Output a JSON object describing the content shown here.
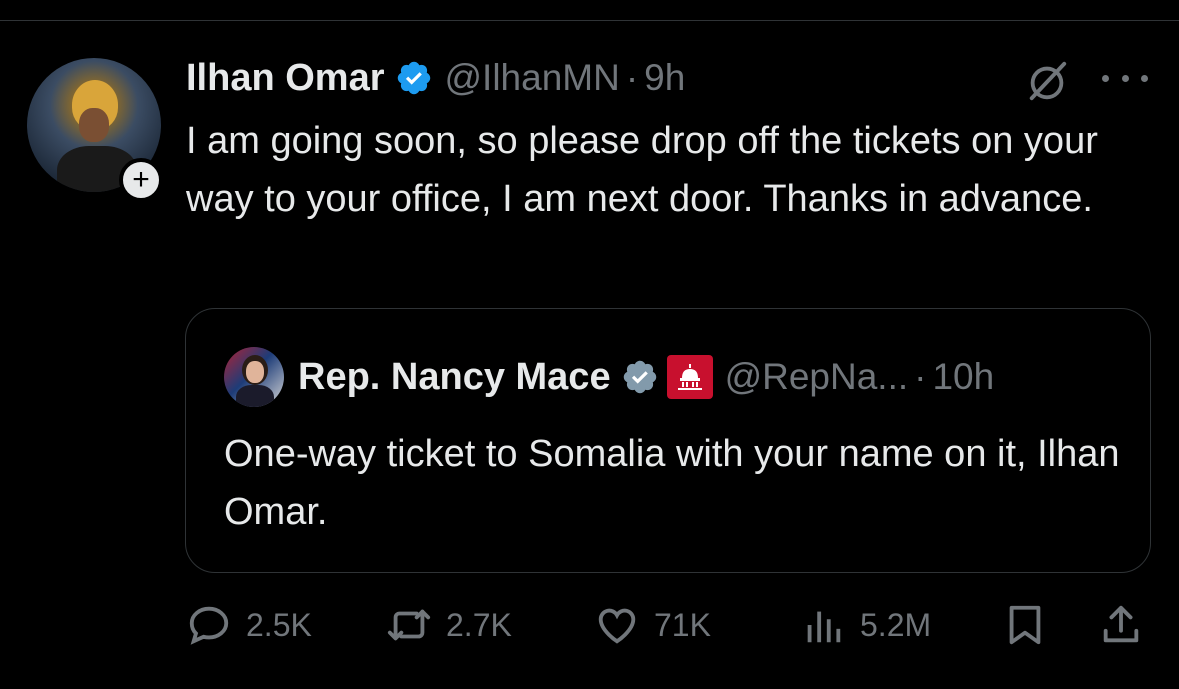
{
  "tweet": {
    "author": {
      "display_name": "Ilhan Omar",
      "handle": "@IlhanMN",
      "verified": true,
      "follow_symbol": "+"
    },
    "separator": "·",
    "time": "9h",
    "text": "I am going soon, so please drop off the tickets on your way to your office, I am next door. Thanks in advance."
  },
  "quote": {
    "author": {
      "display_name": "Rep. Nancy Mace",
      "handle": "@RepNa...",
      "verified": true,
      "affiliate_badge": "house-gop-badge"
    },
    "separator": "·",
    "time": "10h",
    "text": "One-way ticket to Somalia with your name on it, Ilhan Omar."
  },
  "actions": {
    "replies": "2.5K",
    "reposts": "2.7K",
    "likes": "71K",
    "views": "5.2M"
  },
  "colors": {
    "background": "#000000",
    "text_primary": "#e7e9ea",
    "text_secondary": "#71767b",
    "verified_blue": "#1d9bf0",
    "quote_verified": "#829aab",
    "border": "#2f3336",
    "gov_badge": "#c8102e"
  },
  "icons": [
    "verified-badge-icon",
    "grok-icon",
    "more-icon",
    "reply-icon",
    "repost-icon",
    "like-icon",
    "views-icon",
    "bookmark-icon",
    "share-icon"
  ]
}
